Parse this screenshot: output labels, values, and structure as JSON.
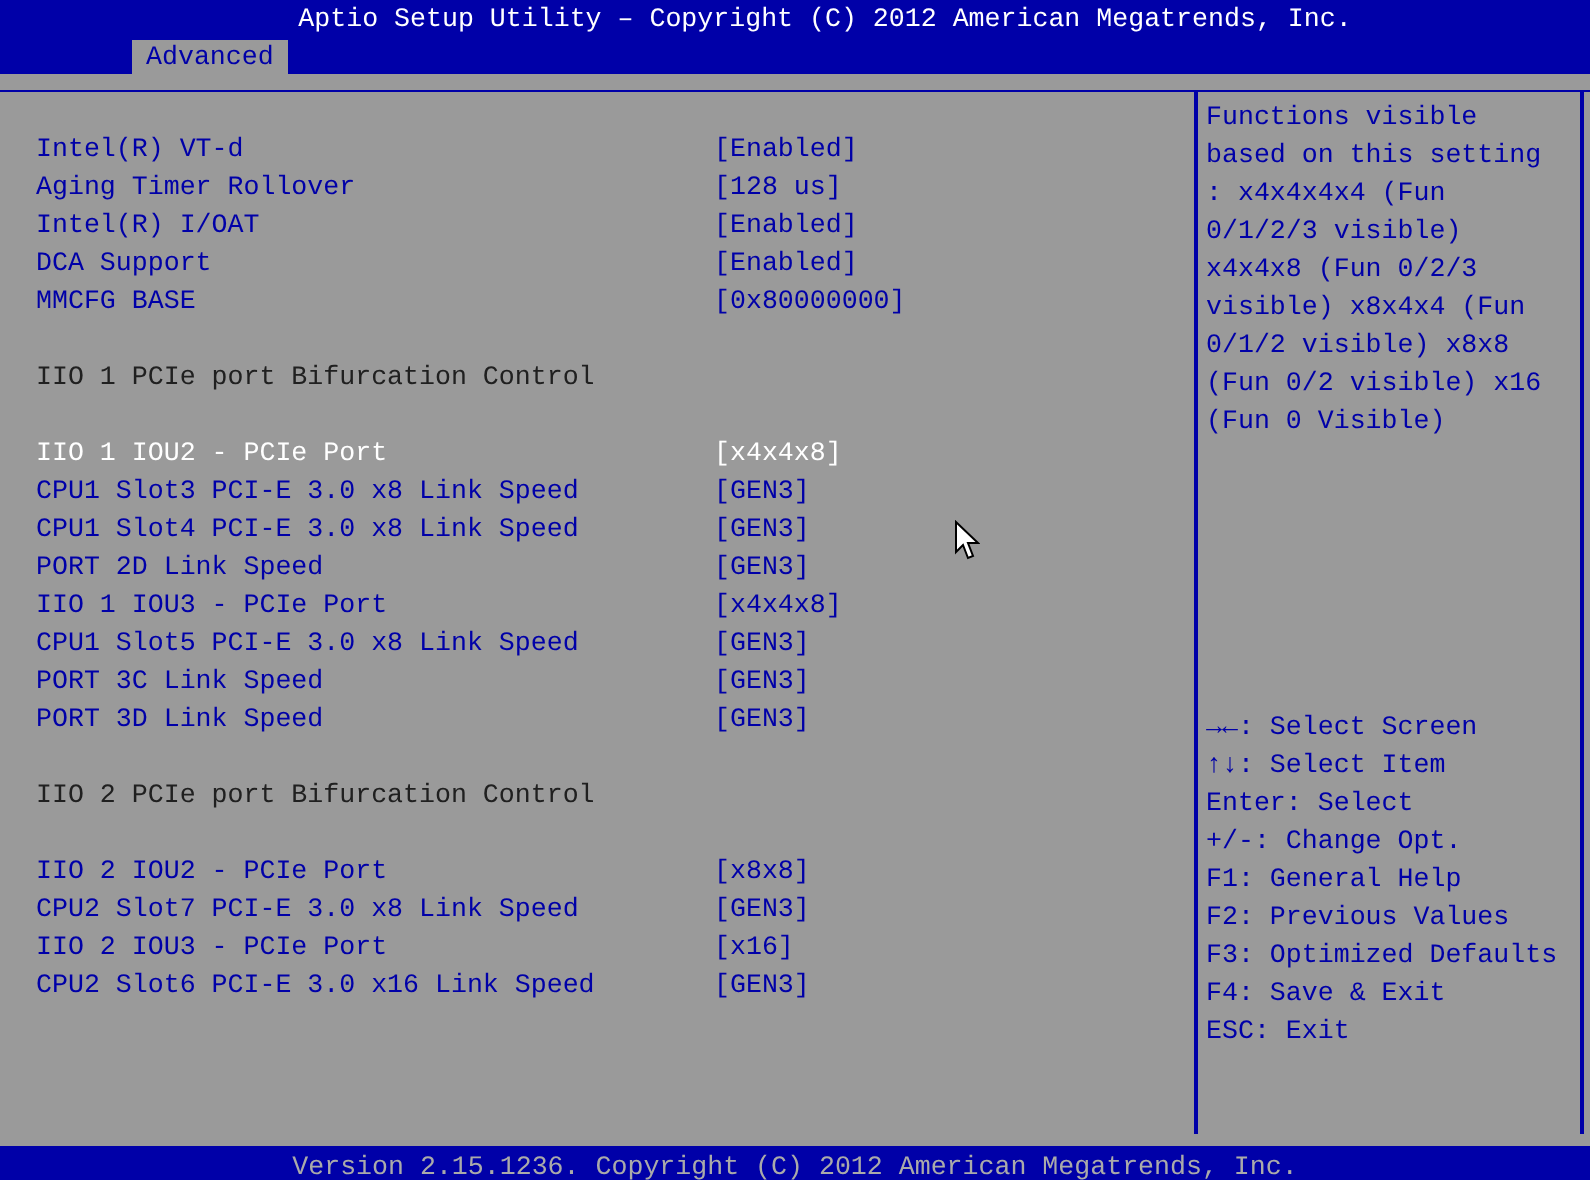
{
  "window": {
    "title": "Aptio Setup Utility – Copyright (C) 2012 American Megatrends, Inc."
  },
  "tabs": [
    {
      "label": "Advanced",
      "selected": true
    }
  ],
  "settings": [
    {
      "kind": "setting",
      "label": "Intel(R) VT-d",
      "value": "[Enabled]",
      "selected": false
    },
    {
      "kind": "setting",
      "label": "Aging Timer Rollover",
      "value": "[128 us]",
      "selected": false
    },
    {
      "kind": "setting",
      "label": "Intel(R) I/OAT",
      "value": "[Enabled]",
      "selected": false
    },
    {
      "kind": "setting",
      "label": "DCA Support",
      "value": "[Enabled]",
      "selected": false
    },
    {
      "kind": "setting",
      "label": "MMCFG BASE",
      "value": "[0x80000000]",
      "selected": false
    },
    {
      "kind": "heading",
      "label": "IIO 1 PCIe port Bifurcation Control"
    },
    {
      "kind": "setting",
      "label": "IIO 1 IOU2 - PCIe Port",
      "value": "[x4x4x8]",
      "selected": true
    },
    {
      "kind": "setting",
      "label": "CPU1 Slot3 PCI-E 3.0 x8 Link Speed",
      "value": "[GEN3]",
      "selected": false
    },
    {
      "kind": "setting",
      "label": "CPU1 Slot4 PCI-E 3.0 x8 Link Speed",
      "value": "[GEN3]",
      "selected": false
    },
    {
      "kind": "setting",
      "label": "PORT 2D Link Speed",
      "value": "[GEN3]",
      "selected": false
    },
    {
      "kind": "setting",
      "label": "IIO 1 IOU3 - PCIe Port",
      "value": "[x4x4x8]",
      "selected": false
    },
    {
      "kind": "setting",
      "label": "CPU1 Slot5 PCI-E 3.0 x8 Link Speed",
      "value": "[GEN3]",
      "selected": false
    },
    {
      "kind": "setting",
      "label": "PORT 3C Link Speed",
      "value": "[GEN3]",
      "selected": false
    },
    {
      "kind": "setting",
      "label": "PORT 3D Link Speed",
      "value": "[GEN3]",
      "selected": false
    },
    {
      "kind": "heading",
      "label": "IIO 2 PCIe port Bifurcation Control"
    },
    {
      "kind": "setting",
      "label": "IIO 2 IOU2 - PCIe Port",
      "value": "[x8x8]",
      "selected": false
    },
    {
      "kind": "setting",
      "label": "CPU2 Slot7 PCI-E 3.0 x8 Link Speed",
      "value": "[GEN3]",
      "selected": false
    },
    {
      "kind": "setting",
      "label": "IIO 2 IOU3 - PCIe Port",
      "value": "[x16]",
      "selected": false
    },
    {
      "kind": "setting",
      "label": "CPU2 Slot6 PCI-E 3.0 x16 Link Speed",
      "value": "[GEN3]",
      "selected": false
    }
  ],
  "help": {
    "text": "Functions visible based on this setting : x4x4x4x4 (Fun 0/1/2/3 visible) x4x4x8 (Fun 0/2/3 visible) x8x4x4 (Fun 0/1/2 visible) x8x8 (Fun 0/2 visible) x16 (Fun 0 Visible)",
    "keys": [
      "**→←**: Select Screen",
      "**↑↓**: Select Item",
      "Enter: Select",
      "+/-: Change Opt.",
      "F1: General Help",
      "F2: Previous Values",
      "F3: Optimized Defaults",
      "F4: Save & Exit",
      "ESC: Exit"
    ]
  },
  "status_bar": "Version 2.15.1236. Copyright (C) 2012 American Megatrends, Inc."
}
